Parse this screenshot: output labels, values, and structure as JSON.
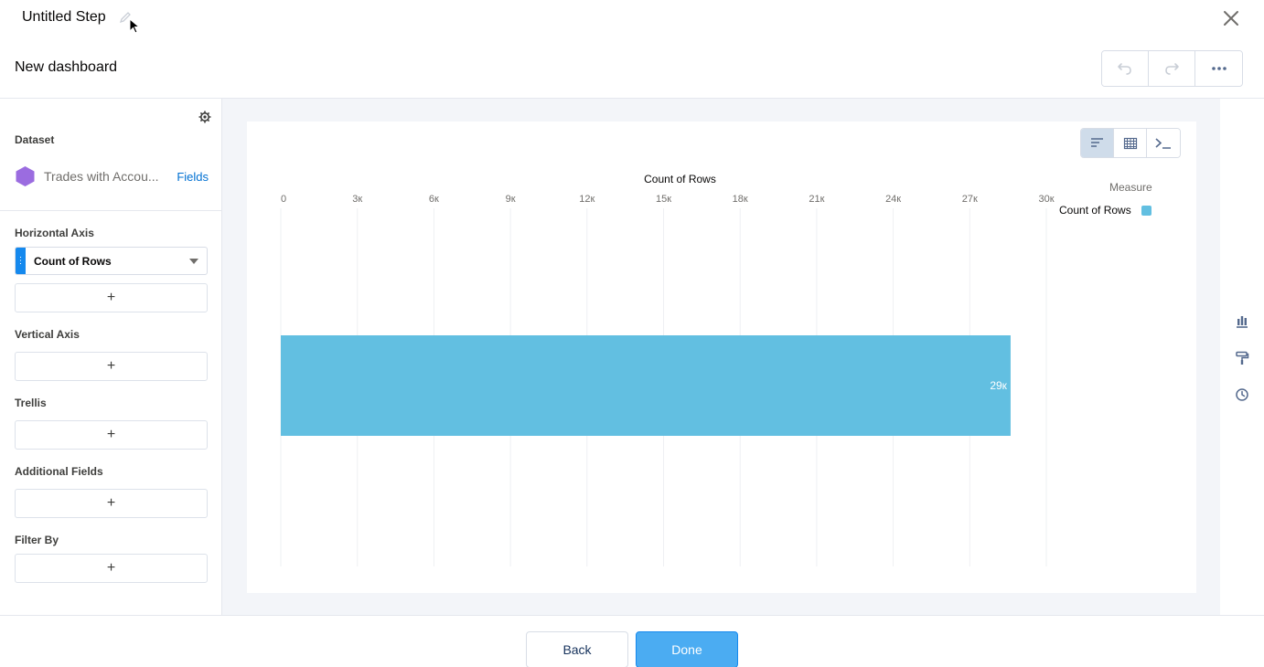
{
  "header": {
    "step_title": "Untitled Step",
    "dashboard_title": "New dashboard",
    "icons": {
      "edit": "pencil-icon",
      "close": "close-icon",
      "undo": "undo-icon",
      "redo": "redo-icon",
      "more": "more-icon"
    }
  },
  "sidebar": {
    "dataset_label": "Dataset",
    "dataset_name": "Trades with Accou...",
    "dataset_color": "#9b6ce0",
    "fields_link": "Fields",
    "horizontal_axis_label": "Horizontal Axis",
    "horizontal_axis_value": "Count of Rows",
    "vertical_axis_label": "Vertical Axis",
    "trellis_label": "Trellis",
    "additional_fields_label": "Additional Fields",
    "filter_by_label": "Filter By",
    "add_symbol": "+"
  },
  "chart_toolbar": {
    "icons": [
      "bar-chart-icon",
      "table-icon",
      "query-editor-icon"
    ]
  },
  "chart_data": {
    "type": "bar",
    "orientation": "horizontal",
    "title": "Count of Rows",
    "xlabel": "Count of Rows",
    "ylabel": "",
    "xlim": [
      0,
      30000
    ],
    "x_ticks": [
      "0",
      "3к",
      "6к",
      "9к",
      "12к",
      "15к",
      "18к",
      "21к",
      "24к",
      "27к",
      "30к"
    ],
    "categories": [
      ""
    ],
    "values": [
      28600
    ],
    "data_labels": [
      "29к"
    ],
    "grid": true,
    "bar_color": "#62bfe1",
    "legend": {
      "title": "Measure",
      "placement": "top-right",
      "items": [
        {
          "name": "Count of Rows",
          "color": "#62bfe1"
        }
      ]
    }
  },
  "right_rail": {
    "icons": [
      "chart-properties-icon",
      "format-icon",
      "history-icon"
    ]
  },
  "footer": {
    "back_label": "Back",
    "done_label": "Done"
  }
}
